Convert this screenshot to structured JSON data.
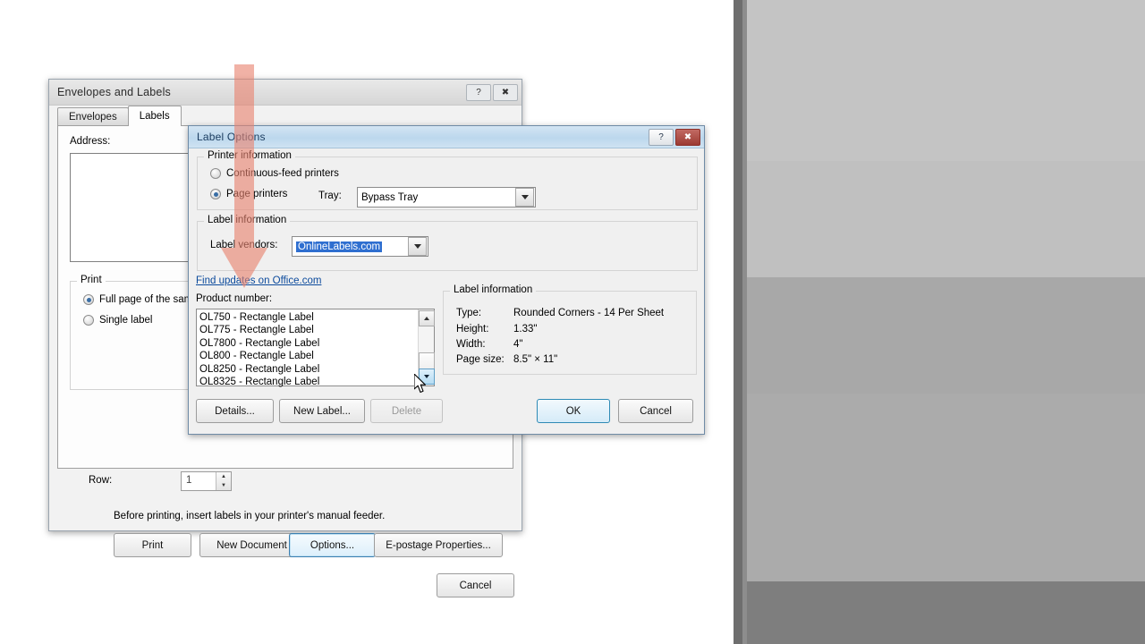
{
  "envelopes_dialog": {
    "title": "Envelopes and Labels",
    "help_icon": "?",
    "close_icon": "✖",
    "tabs": [
      {
        "label": "Envelopes",
        "active": false
      },
      {
        "label": "Labels",
        "active": true
      }
    ],
    "address_label": "Address:",
    "address_value": "",
    "print_group": {
      "caption": "Print",
      "options": [
        {
          "label": "Full page of the same label",
          "selected": true
        },
        {
          "label": "Single label",
          "selected": false
        }
      ],
      "row_label": "Row:",
      "row_value": "1"
    },
    "footer_note": "Before printing, insert labels in your printer's manual feeder.",
    "buttons": {
      "print": "Print",
      "new_document": "New Document",
      "options": "Options...",
      "epostage": "E-postage Properties...",
      "cancel": "Cancel"
    }
  },
  "label_options_dialog": {
    "title": "Label Options",
    "help_icon": "?",
    "close_icon": "✖",
    "printer_information": {
      "caption": "Printer information",
      "options": [
        {
          "label": "Continuous-feed printers",
          "selected": false
        },
        {
          "label": "Page printers",
          "selected": true
        }
      ],
      "tray_label": "Tray:",
      "tray_value": "Bypass Tray"
    },
    "label_information_group": {
      "caption": "Label information",
      "vendors_label": "Label vendors:",
      "vendors_value": "OnlineLabels.com"
    },
    "find_updates_link": "Find updates on Office.com",
    "product_number": {
      "label": "Product number:",
      "items": [
        "OL750 - Rectangle Label",
        "OL775 - Rectangle Label",
        "OL7800 - Rectangle Label",
        "OL800 - Rectangle Label",
        "OL8250 - Rectangle Label",
        "OL8325 - Rectangle Label"
      ]
    },
    "label_information_panel": {
      "caption": "Label information",
      "rows": [
        {
          "key": "Type:",
          "value": "Rounded Corners - 14 Per Sheet"
        },
        {
          "key": "Height:",
          "value": "1.33\""
        },
        {
          "key": "Width:",
          "value": "4\""
        },
        {
          "key": "Page size:",
          "value": "8.5\" × 11\""
        }
      ]
    },
    "buttons": {
      "details": "Details...",
      "new_label": "New Label...",
      "delete": "Delete",
      "ok": "OK",
      "cancel": "Cancel"
    }
  },
  "annotation": {
    "arrow_color": "#e8836f",
    "arrow_direction": "down"
  },
  "colors": {
    "selection_blue": "#2f6fd0",
    "link_blue": "#0b4a9c",
    "close_red": "#9c3b33",
    "focus_blue": "#3c7fb1"
  }
}
